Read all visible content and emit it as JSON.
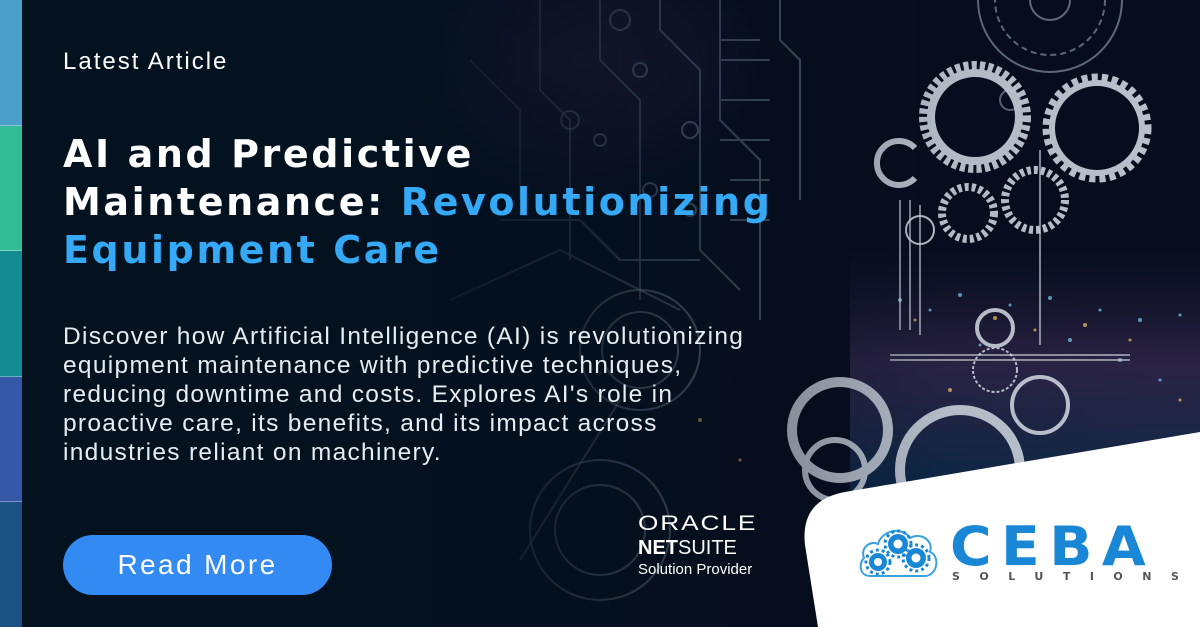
{
  "strip": {
    "colors": [
      "#4aa0c8",
      "#33bd94",
      "#138a8f",
      "#3557a8",
      "#1b5283"
    ]
  },
  "eyebrow": "Latest Article",
  "headline": {
    "line1": "AI and Predictive",
    "line2_plain": "Maintenance: ",
    "line2_accent": "Revolutionizing",
    "line3_accent": "Equipment Care",
    "accent_color": "#35a9f5"
  },
  "description": "Discover how Artificial Intelligence (AI) is revolutionizing equipment maintenance with predictive techniques, reducing downtime and costs. Explores AI's role in proactive care, its benefits, and its impact across industries reliant on machinery.",
  "cta": {
    "label": "Read More",
    "color": "#338af3"
  },
  "partner": {
    "brand": "ORACLE",
    "product_bold": "NET",
    "product_rest": "SUITE",
    "tagline": "Solution Provider"
  },
  "company_logo": {
    "name": "CEBA",
    "subtitle": "SOLUTIONS",
    "icon": "cloud-gears-icon",
    "color": "#1a87d6"
  }
}
